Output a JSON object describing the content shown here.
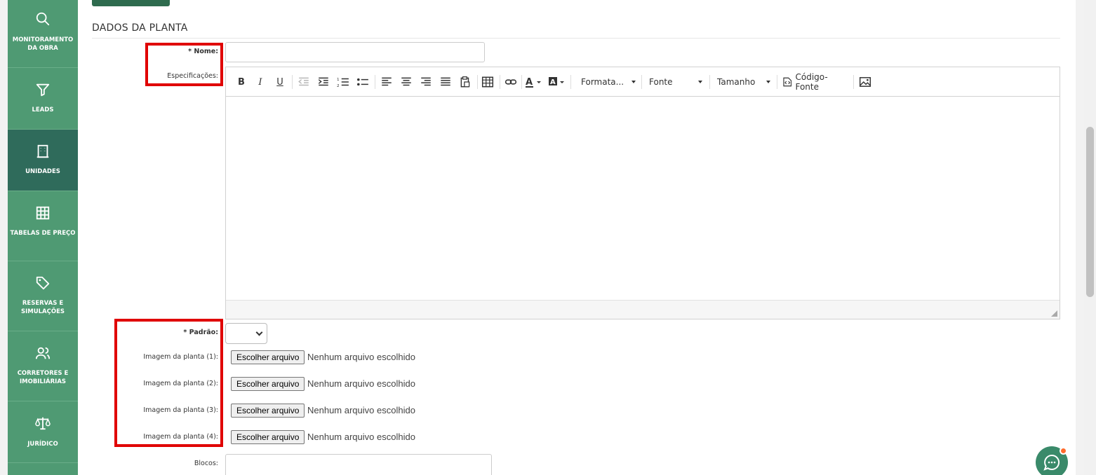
{
  "sidebar": {
    "items": [
      {
        "label": "MONITORAMENTO DA OBRA",
        "icon": "search-icon",
        "active": false
      },
      {
        "label": "LEADS",
        "icon": "funnel-icon",
        "active": false
      },
      {
        "label": "UNIDADES",
        "icon": "building-icon",
        "active": true
      },
      {
        "label": "TABELAS DE PREÇO",
        "icon": "grid-icon",
        "active": false
      },
      {
        "label": "RESERVAS E SIMULAÇÕES",
        "icon": "tag-icon",
        "active": false
      },
      {
        "label": "CORRETORES E IMOBILIÁRIAS",
        "icon": "users-icon",
        "active": false
      },
      {
        "label": "JURÍDICO",
        "icon": "scales-icon",
        "active": false
      }
    ]
  },
  "form": {
    "section_title": "DADOS DA PLANTA",
    "nome_label": "* Nome:",
    "nome_value": "",
    "especificacoes_label": "Especificações:",
    "editor": {
      "formatacao_label": "Formata...",
      "fonte_label": "Fonte",
      "tamanho_label": "Tamanho",
      "codigo_fonte_label": "Código-Fonte",
      "content": ""
    },
    "padrao_label": "* Padrão:",
    "padrao_value": "",
    "images": [
      {
        "label": "Imagem da planta (1):",
        "button": "Escolher arquivo",
        "status": "Nenhum arquivo escolhido"
      },
      {
        "label": "Imagem da planta (2):",
        "button": "Escolher arquivo",
        "status": "Nenhum arquivo escolhido"
      },
      {
        "label": "Imagem da planta (3):",
        "button": "Escolher arquivo",
        "status": "Nenhum arquivo escolhido"
      },
      {
        "label": "Imagem da planta (4):",
        "button": "Escolher arquivo",
        "status": "Nenhum arquivo escolhido"
      }
    ],
    "blocos_label": "Blocos:"
  },
  "colors": {
    "sidebar_bg": "#4f9a73",
    "sidebar_active": "#2f6b5b",
    "highlight": "#e00000",
    "chat_bg": "#3a8a6a",
    "chat_dot": "#ff6a2b"
  }
}
